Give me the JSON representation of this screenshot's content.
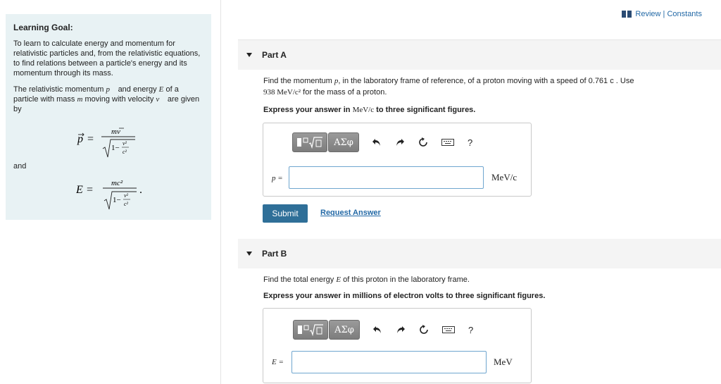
{
  "learning_goal": {
    "title": "Learning Goal:",
    "para1": "To learn to calculate energy and momentum for relativistic particles and, from the relativistic equations, to find relations between a particle's energy and its momentum through its mass.",
    "para2_pre": "The relativistic momentum",
    "para2_mid1": "and energy",
    "para2_mid2": "of a particle with mass",
    "para2_mid3": "moving with velocity",
    "para2_post": "are given by",
    "and_word": "and",
    "momentum_symbol": "p⃗",
    "energy_symbol": "E",
    "mass_symbol": "m",
    "velocity_symbol": "v⃗"
  },
  "header": {
    "review_link": "Review | Constants",
    "book_icon": "book-icon"
  },
  "part_a": {
    "title": "Part A",
    "question_pre": "Find the momentum",
    "question_var": "p",
    "question_mid": ", in the laboratory frame of reference, of a proton moving with a speed of 0.761",
    "question_c": "c",
    "question_end": ". Use",
    "question_line2_value": "938 MeV/c²",
    "question_line2_rest": "for the mass of a proton.",
    "instruction_pre": "Express your answer in",
    "instruction_unit": "MeV/c",
    "instruction_post": "to three significant figures.",
    "answer_label": "p =",
    "answer_value": "",
    "unit": "MeV/c",
    "submit": "Submit",
    "request_answer": "Request Answer"
  },
  "part_b": {
    "title": "Part B",
    "question_pre": "Find the total energy",
    "question_var": "E",
    "question_post": "of this proton in the laboratory frame.",
    "instruction": "Express your answer in millions of electron volts to three significant figures.",
    "answer_label": "E =",
    "answer_value": "",
    "unit": "MeV"
  },
  "toolbar": {
    "symbols_label": "ΑΣφ",
    "help_label": "?",
    "icons": [
      "templates-icon",
      "undo-icon",
      "redo-icon",
      "reset-icon",
      "keyboard-icon",
      "help-icon"
    ]
  }
}
